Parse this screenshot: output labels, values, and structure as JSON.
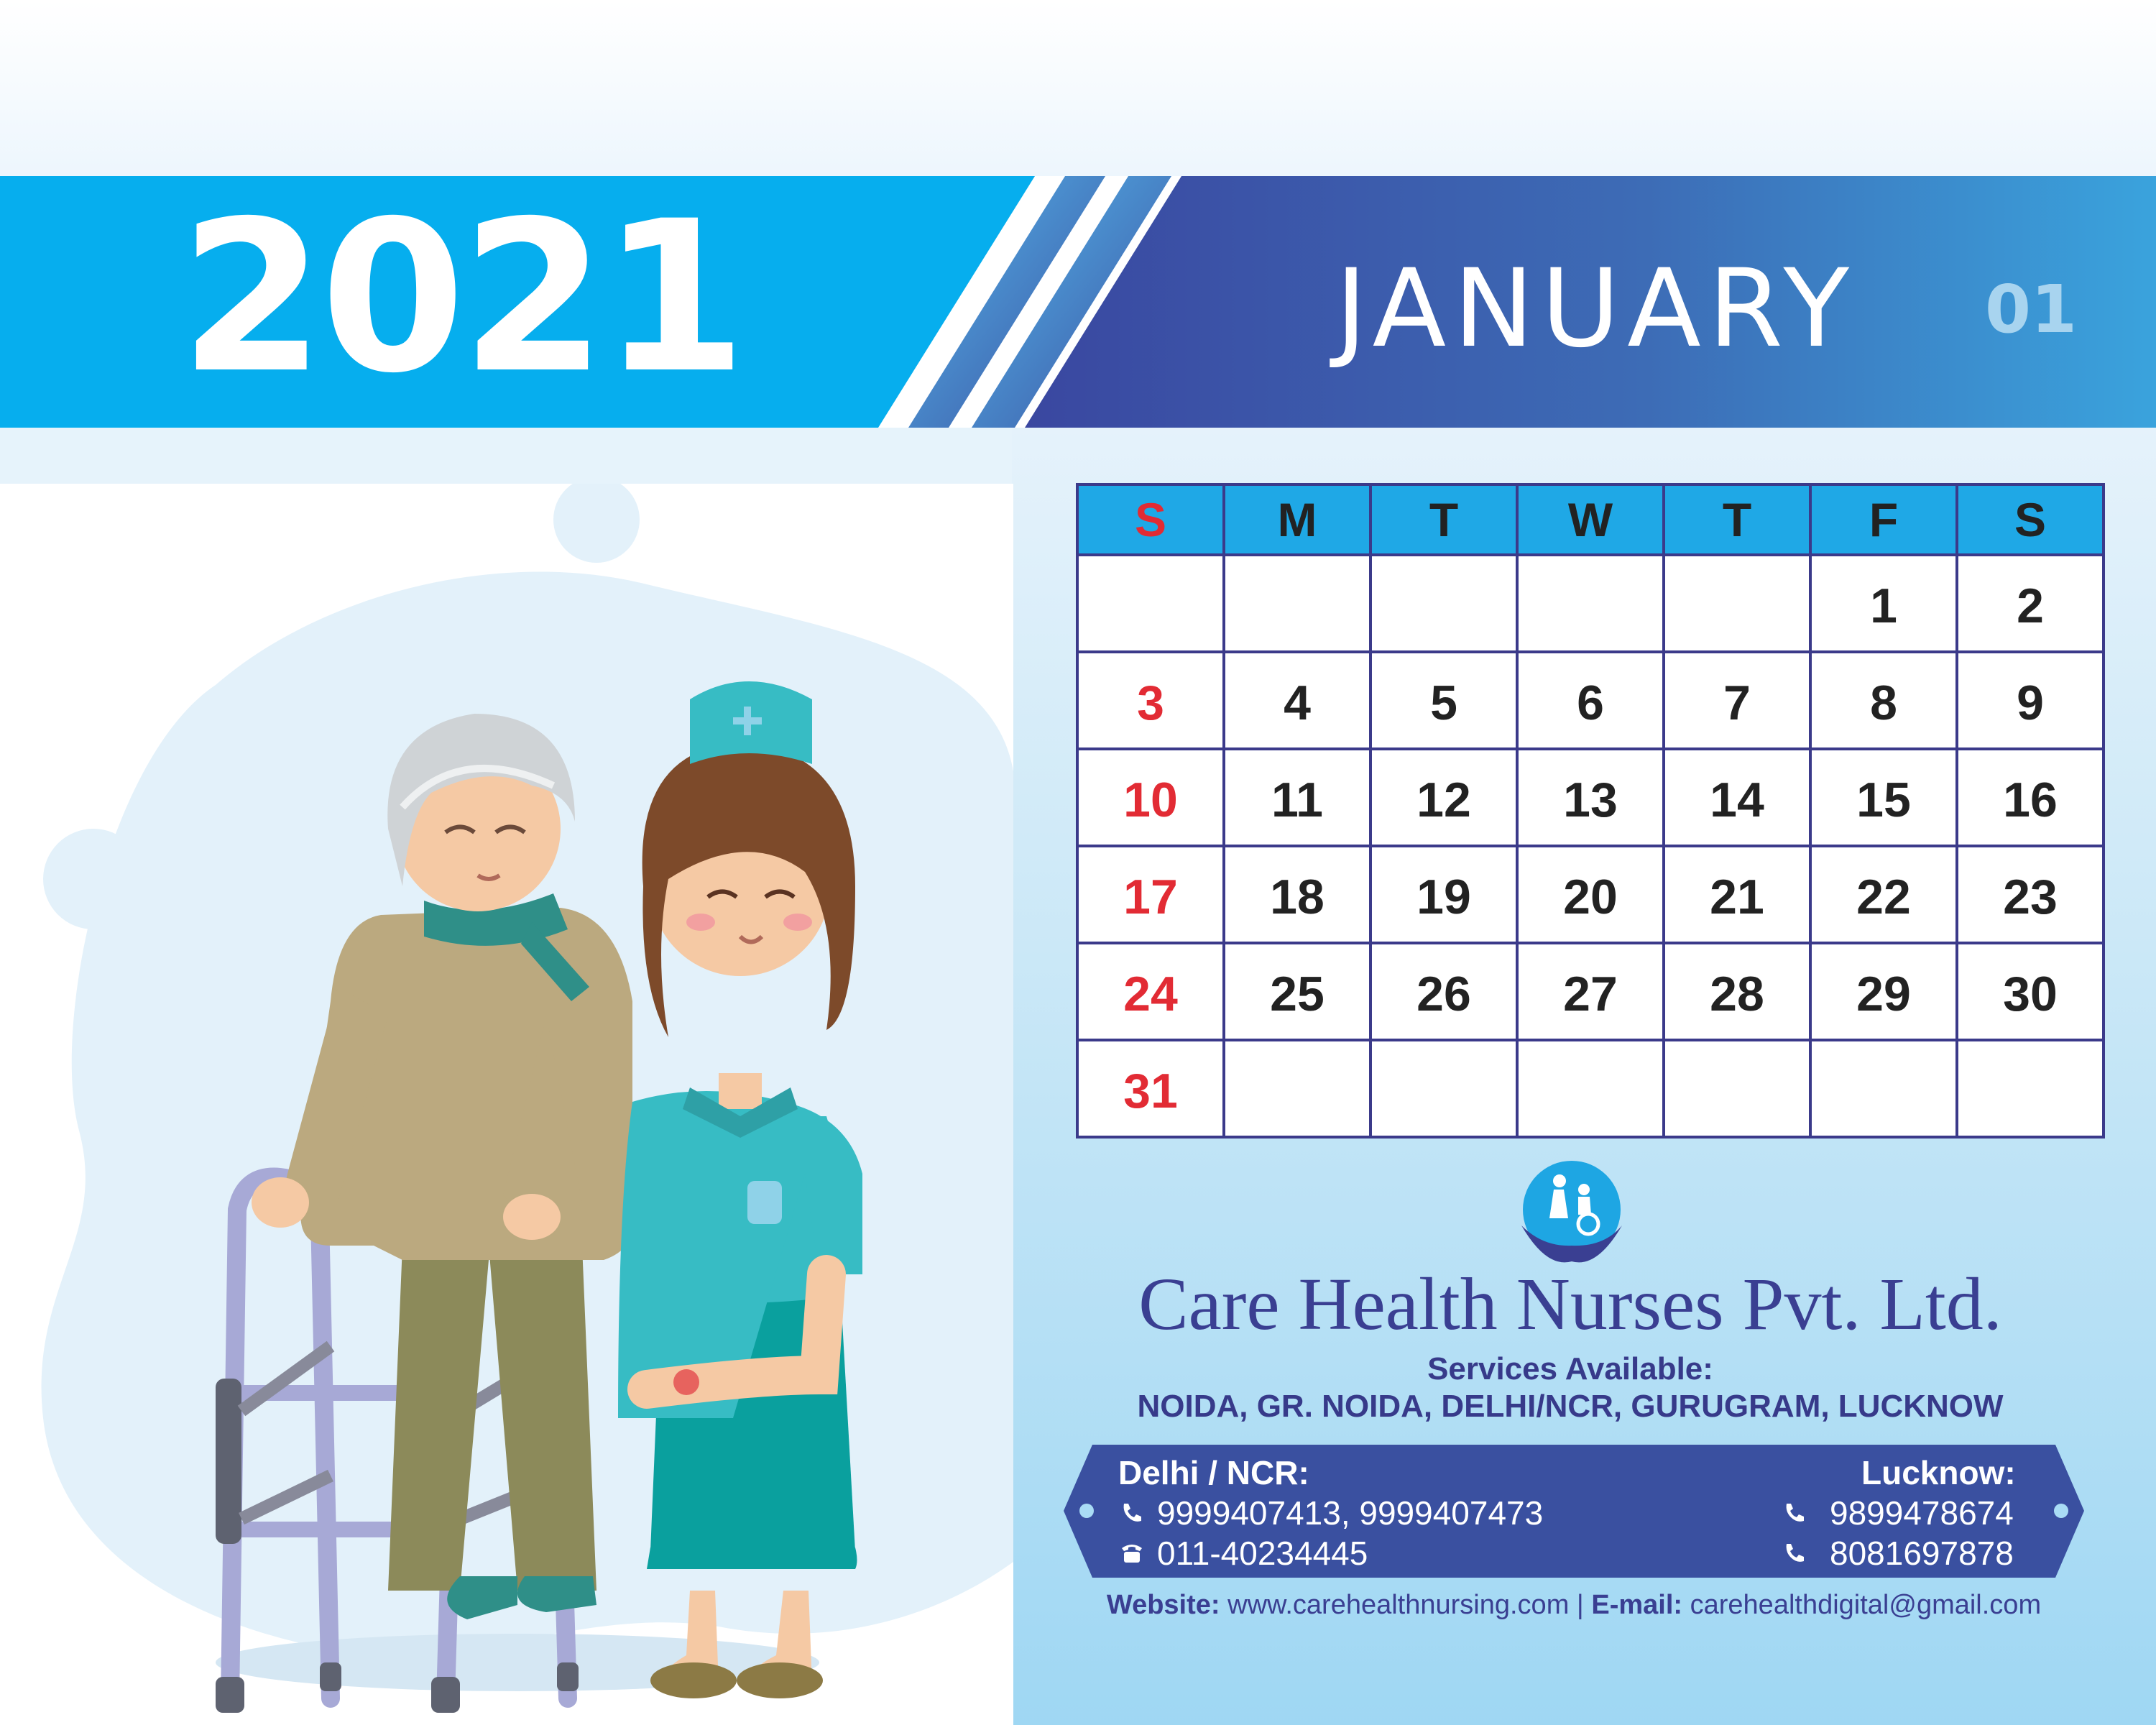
{
  "header": {
    "year": "2021",
    "month": "JANUARY",
    "month_number": "01"
  },
  "calendar": {
    "weekdays": [
      "S",
      "M",
      "T",
      "W",
      "T",
      "F",
      "S"
    ],
    "weeks": [
      [
        "",
        "",
        "",
        "",
        "",
        "1",
        "2"
      ],
      [
        "3",
        "4",
        "5",
        "6",
        "7",
        "8",
        "9"
      ],
      [
        "10",
        "11",
        "12",
        "13",
        "14",
        "15",
        "16"
      ],
      [
        "17",
        "18",
        "19",
        "20",
        "21",
        "22",
        "23"
      ],
      [
        "24",
        "25",
        "26",
        "27",
        "28",
        "29",
        "30"
      ],
      [
        "31",
        "",
        "",
        "",
        "",
        "",
        ""
      ]
    ]
  },
  "company": {
    "name": "Care Health Nurses Pvt. Ltd.",
    "services_label": "Services Available:",
    "locations": "NOIDA, GR. NOIDA, DELHI/NCR, GURUGRAM, LUCKNOW"
  },
  "contact": {
    "delhi_label": "Delhi / NCR:",
    "delhi_mobiles": "9999407413, 9999407473",
    "delhi_landline": "011-40234445",
    "lucknow_label": "Lucknow:",
    "lucknow_phone_1": "9899478674",
    "lucknow_phone_2": "8081697878"
  },
  "footer": {
    "website_label": "Website:",
    "website": "www.carehealthnursing.com",
    "separator": "|",
    "email_label": "E-mail:",
    "email": "carehealthdigital@gmail.com"
  },
  "colors": {
    "banner_blue": "#06aeee",
    "banner_navy": "#3a4fa0",
    "calendar_header": "#1fa8e6",
    "sunday_red": "#e22b34",
    "grid_navy": "#3b3a8a",
    "brand_text": "#3a3f92"
  },
  "icons": [
    "mobile-phone-icon",
    "landline-phone-icon",
    "care-logo-icon"
  ]
}
